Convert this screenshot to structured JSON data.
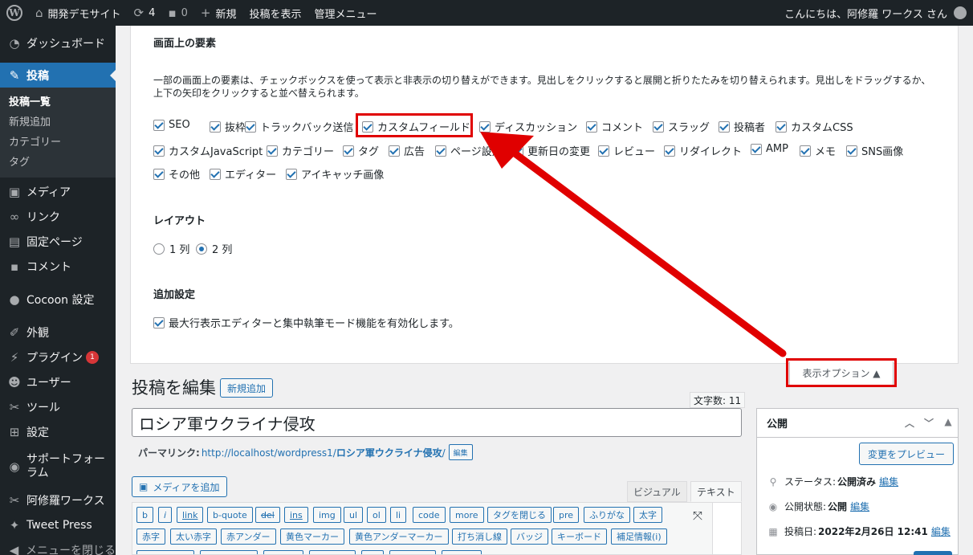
{
  "adminbar": {
    "site_name": "開発デモサイト",
    "updates_count": "4",
    "comments_count": "0",
    "new_label": "新規",
    "view_post": "投稿を表示",
    "admin_menu": "管理メニュー",
    "greeting": "こんにちは、阿修羅 ワークス さん"
  },
  "sidebar": {
    "items": [
      {
        "label": "ダッシュボード",
        "icon": "dashboard-icon"
      },
      {
        "label": "投稿",
        "icon": "pin-icon"
      },
      {
        "label": "メディア",
        "icon": "media-icon"
      },
      {
        "label": "リンク",
        "icon": "link-icon"
      },
      {
        "label": "固定ページ",
        "icon": "page-icon"
      },
      {
        "label": "コメント",
        "icon": "comment-icon"
      },
      {
        "label": "Cocoon 設定",
        "icon": "circle-icon"
      },
      {
        "label": "外観",
        "icon": "brush-icon"
      },
      {
        "label": "プラグイン",
        "icon": "plugin-icon",
        "badge": "1"
      },
      {
        "label": "ユーザー",
        "icon": "user-icon"
      },
      {
        "label": "ツール",
        "icon": "wrench-icon"
      },
      {
        "label": "設定",
        "icon": "settings-icon"
      },
      {
        "label": "サポートフォーラム",
        "icon": "support-icon"
      },
      {
        "label": "阿修羅ワークス",
        "icon": "wrench-icon"
      },
      {
        "label": "Tweet Press",
        "icon": "twitter-icon"
      },
      {
        "label": "メニューを閉じる",
        "icon": "collapse-icon"
      }
    ],
    "submenu": [
      "投稿一覧",
      "新規追加",
      "カテゴリー",
      "タグ"
    ]
  },
  "screen_options": {
    "elements_heading": "画面上の要素",
    "description": "一部の画面上の要素は、チェックボックスを使って表示と非表示の切り替えができます。見出しをクリックすると展開と折りたたみを切り替えられます。見出しをドラッグするか、上下の矢印をクリックすると並べ替えられます。",
    "checkboxes": [
      "SEO",
      "抜枠",
      "トラックバック送信",
      "カスタムフィールド",
      "ディスカッション",
      "コメント",
      "スラッグ",
      "投稿者",
      "カスタムCSS",
      "カスタムJavaScript",
      "カテゴリー",
      "タグ",
      "広告",
      "ページ設定",
      "更新日の変更",
      "レビュー",
      "リダイレクト",
      "AMP",
      "メモ",
      "SNS画像",
      "その他",
      "エディター",
      "アイキャッチ画像"
    ],
    "layout_heading": "レイアウト",
    "layout_options": [
      "1 列",
      "2 列"
    ],
    "extra_heading": "追加設定",
    "extra_checkbox": "最大行表示エディターと集中執筆モード機能を有効化します。",
    "tab_label": "表示オプション ▲"
  },
  "editor": {
    "page_title": "投稿を編集",
    "add_new": "新規追加",
    "word_count": "文字数: 11",
    "post_title": "ロシア軍ウクライナ侵攻",
    "permalink_label": "パーマリンク:",
    "permalink_base": "http://localhost/wordpress1/",
    "permalink_slug": "ロシア軍ウクライナ侵攻",
    "permalink_end": "/",
    "permalink_edit": "編集",
    "add_media": "メディアを追加",
    "tab_visual": "ビジュアル",
    "tab_text": "テキスト",
    "quicktags_row1": [
      "b",
      "i",
      "link",
      "b-quote",
      "del",
      "ins",
      "img",
      "ul",
      "ol",
      "li",
      "code",
      "more",
      "タグを閉じる",
      "pre",
      "ふりがな",
      "太字"
    ],
    "quicktags_row2": [
      "赤字",
      "太い赤字",
      "赤アンダー",
      "黄色マーカー",
      "黄色アンダーマーカー",
      "打ち消し線",
      "バッジ",
      "キーボード",
      "補足情報(i)"
    ]
  },
  "publish": {
    "title": "公開",
    "preview": "変更をプレビュー",
    "status_label": "ステータス:",
    "status_value": "公開済み",
    "visibility_label": "公開状態:",
    "visibility_value": "公開",
    "date_label": "投稿日:",
    "date_value": "2022年2月26日 12:41",
    "edit": "編集"
  },
  "colors": {
    "accent": "#2271b1",
    "annotation": "#e00000"
  }
}
